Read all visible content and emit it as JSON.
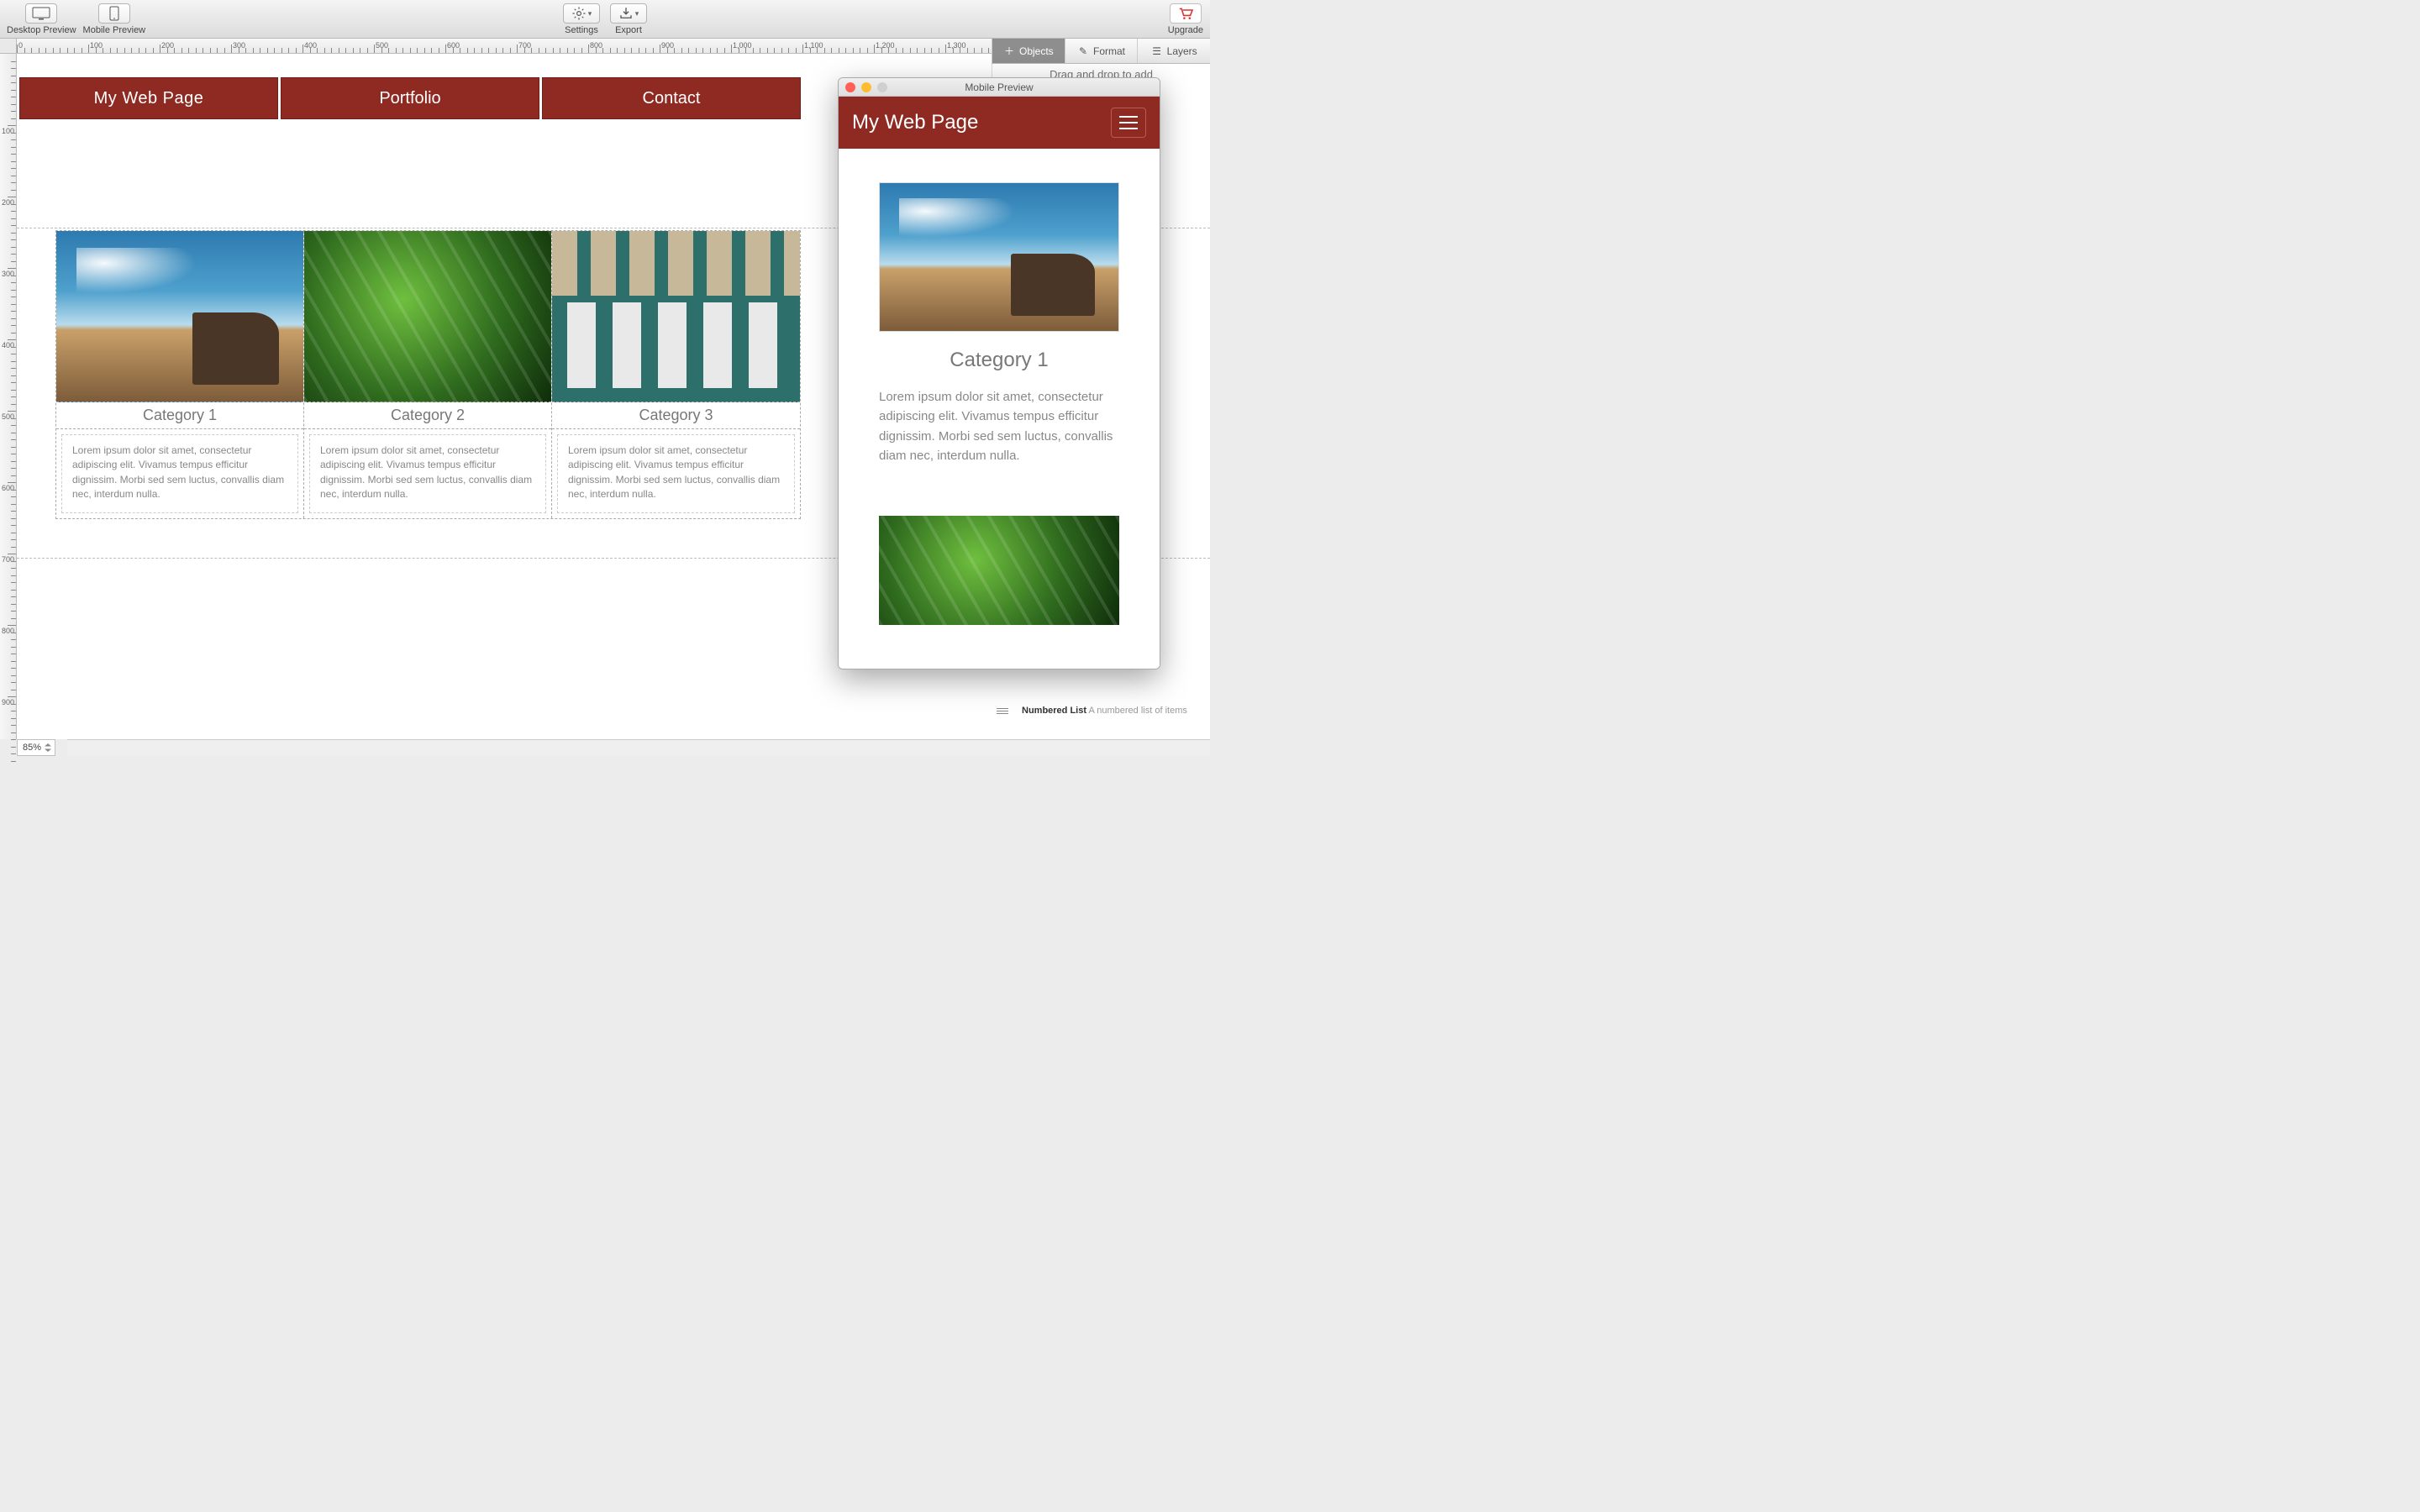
{
  "toolbar": {
    "desktop_preview": "Desktop Preview",
    "mobile_preview": "Mobile Preview",
    "settings": "Settings",
    "export": "Export",
    "upgrade": "Upgrade"
  },
  "inspector": {
    "tabs": {
      "objects": "Objects",
      "format": "Format",
      "layers": "Layers"
    },
    "drag_hint": "Drag and drop to add",
    "numbered_list_title": "Numbered List",
    "numbered_list_desc": "A numbered list of items"
  },
  "ruler_marks": [
    0,
    100,
    200,
    300,
    400,
    500,
    600,
    700,
    800,
    900,
    1000,
    1100,
    1200,
    1300
  ],
  "vruler_marks": [
    100,
    200,
    300,
    400,
    500,
    600,
    700,
    800,
    900
  ],
  "canvas": {
    "nav": [
      "My Web Page",
      "Portfolio",
      "Contact"
    ],
    "categories": [
      {
        "title": "Category 1",
        "text": "Lorem ipsum dolor sit amet, consectetur adipiscing elit. Vivamus tempus efficitur dignissim. Morbi sed sem luctus, convallis diam nec, interdum nulla."
      },
      {
        "title": "Category 2",
        "text": "Lorem ipsum dolor sit amet, consectetur adipiscing elit. Vivamus tempus efficitur dignissim. Morbi sed sem luctus, convallis diam nec, interdum nulla."
      },
      {
        "title": "Category 3",
        "text": "Lorem ipsum dolor sit amet, consectetur adipiscing elit. Vivamus tempus efficitur dignissim. Morbi sed sem luctus, convallis diam nec, interdum nulla."
      }
    ]
  },
  "mobile": {
    "window_title": "Mobile Preview",
    "nav_title": "My Web Page",
    "cat_title": "Category 1",
    "cat_text": "Lorem ipsum dolor sit amet, consectetur adipiscing elit. Vivamus tempus efficitur dignissim. Morbi sed sem luctus, convallis diam nec, interdum nulla."
  },
  "zoom": "85%",
  "colors": {
    "brand": "#8e2a22"
  }
}
